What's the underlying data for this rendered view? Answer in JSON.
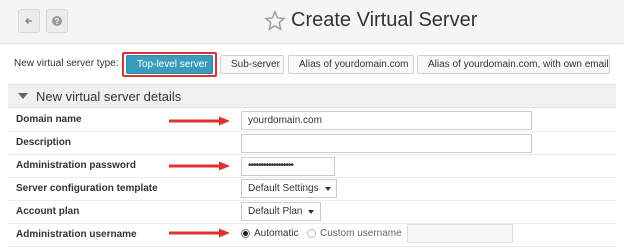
{
  "header": {
    "title": "Create Virtual Server",
    "back_icon": "arrow-left-icon",
    "help_icon": "question-circle-icon",
    "star_icon": "star-outline-icon"
  },
  "server_type": {
    "label": "New virtual server type:",
    "options": [
      {
        "label": "Top-level server",
        "icon": "plus-square-icon",
        "selected": true
      },
      {
        "label": "Sub-server",
        "icon": "level-down-icon",
        "selected": false
      },
      {
        "label": "Alias of yourdomain.com",
        "icon": "share-icon",
        "selected": false
      },
      {
        "label": "Alias of yourdomain.com, with own email",
        "icon": "share-icon",
        "selected": false
      }
    ]
  },
  "section": {
    "title": "New virtual server details"
  },
  "form": {
    "domain_name": {
      "label": "Domain name",
      "value": "yourdomain.com"
    },
    "description": {
      "label": "Description",
      "value": ""
    },
    "admin_password": {
      "label": "Administration password",
      "value": "••••••••••••••••••"
    },
    "config_template": {
      "label": "Server configuration template",
      "value": "Default Settings"
    },
    "account_plan": {
      "label": "Account plan",
      "value": "Default Plan"
    },
    "admin_username": {
      "label": "Administration username",
      "automatic_label": "Automatic",
      "custom_label": "Custom username",
      "selected": "Automatic",
      "custom_value": ""
    }
  },
  "colors": {
    "active_button": "#3a9cbd",
    "highlight": "#e03030"
  }
}
